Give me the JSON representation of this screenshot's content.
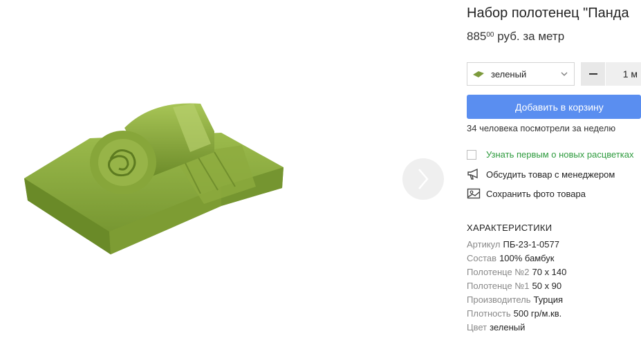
{
  "product": {
    "title": "Набор полотенец \"Панда",
    "price_main": "885",
    "price_cents": "00",
    "price_unit": "руб. за метр"
  },
  "color_select": {
    "value": "зеленый",
    "swatch_color": "#7c9a3c"
  },
  "quantity": {
    "value": "1 м"
  },
  "cart": {
    "add_label": "Добавить в корзину",
    "button_color": "#5a8ef0"
  },
  "views_text": "34 человека посмотрели за неделю",
  "options": {
    "notify_label": "Узнать первым о новых расцветках",
    "discuss_label": "Обсудить товар с менеджером",
    "save_photo_label": "Сохранить фото товара"
  },
  "specs": {
    "heading": "ХАРАКТЕРИСТИКИ",
    "rows": [
      {
        "key": "Артикул",
        "value": "ПБ-23-1-0577"
      },
      {
        "key": "Состав",
        "value": "100% бамбук"
      },
      {
        "key": "Полотенце №2",
        "value": "70 x 140"
      },
      {
        "key": "Полотенце №1",
        "value": "50 x 90"
      },
      {
        "key": "Производитель",
        "value": "Турция"
      },
      {
        "key": "Плотность",
        "value": "500 гр/м.кв."
      },
      {
        "key": "Цвет",
        "value": "зеленый"
      }
    ]
  },
  "icons": {
    "next": "chevron-right-icon",
    "dropdown": "chevron-down-icon",
    "discuss": "megaphone-icon",
    "save_photo": "photo-icon"
  },
  "accent_green": "#2e9b3e"
}
